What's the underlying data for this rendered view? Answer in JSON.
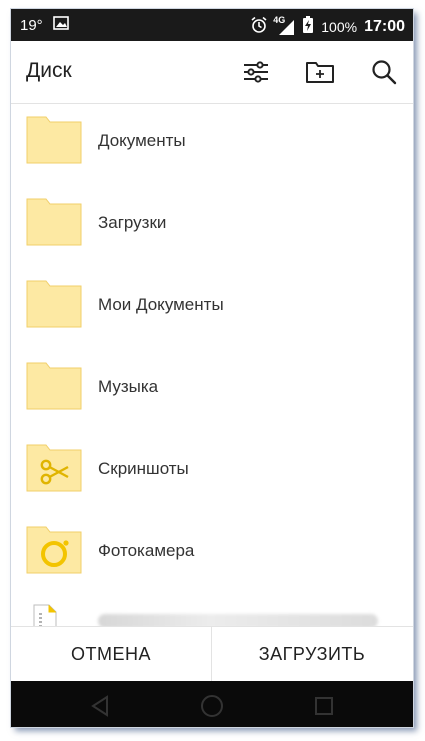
{
  "status": {
    "temperature": "19°",
    "battery": "100%",
    "time": "17:00",
    "network": "4G"
  },
  "appbar": {
    "title": "Диск",
    "actions": [
      "settings-sliders-icon",
      "new-folder-icon",
      "search-icon"
    ]
  },
  "folders": [
    {
      "name": "Документы",
      "type": "plain"
    },
    {
      "name": "Загрузки",
      "type": "plain"
    },
    {
      "name": "Мои Документы",
      "type": "plain"
    },
    {
      "name": "Музыка",
      "type": "plain"
    },
    {
      "name": "Скриншоты",
      "type": "scissors"
    },
    {
      "name": "Фотокамера",
      "type": "camera"
    }
  ],
  "bottom": {
    "cancel": "ОТМЕНА",
    "upload": "ЗАГРУЗИТЬ"
  },
  "colors": {
    "folder_fill": "#fde9a3",
    "folder_stroke": "#f1cf6a",
    "folder_accent": "#f3c400",
    "statusbar_bg": "#1a1a1a",
    "navbar_bg": "#0a0a0a"
  }
}
